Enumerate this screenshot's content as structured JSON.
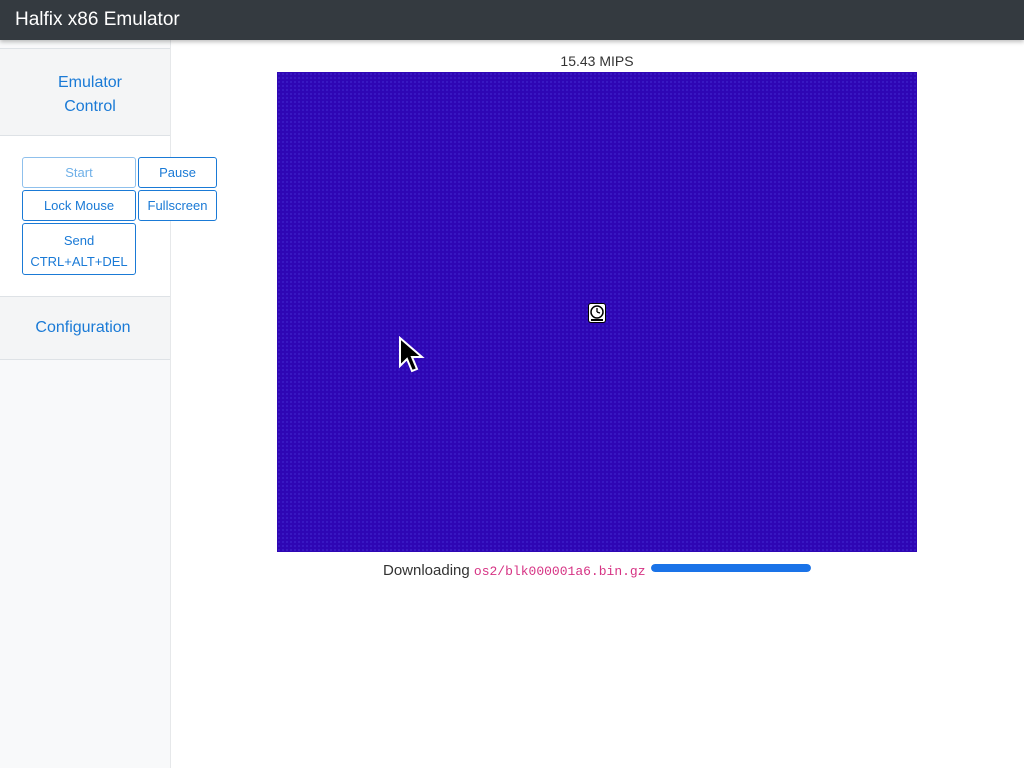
{
  "navbar": {
    "title": "Halfix x86 Emulator"
  },
  "sidebar": {
    "emulator_control_label": "Emulator Control",
    "configuration_label": "Configuration",
    "buttons": {
      "start": "Start",
      "pause": "Pause",
      "lock_mouse": "Lock Mouse",
      "fullscreen": "Fullscreen",
      "send_cad_line1": "Send",
      "send_cad_line2": "CTRL+ALT+DEL"
    }
  },
  "main": {
    "mips": "15.43 MIPS",
    "download_prefix": "Downloading",
    "download_file": "os2/blk000001a6.bin.gz",
    "download_progress": 1.0
  },
  "colors": {
    "navbar_bg": "#343a40",
    "accent": "#1a7ad6",
    "screen_bg": "#2e06b4",
    "progress": "#1a73e8",
    "code_text": "#d63384"
  },
  "icons": [
    "clock-icon",
    "mouse-cursor-icon"
  ]
}
